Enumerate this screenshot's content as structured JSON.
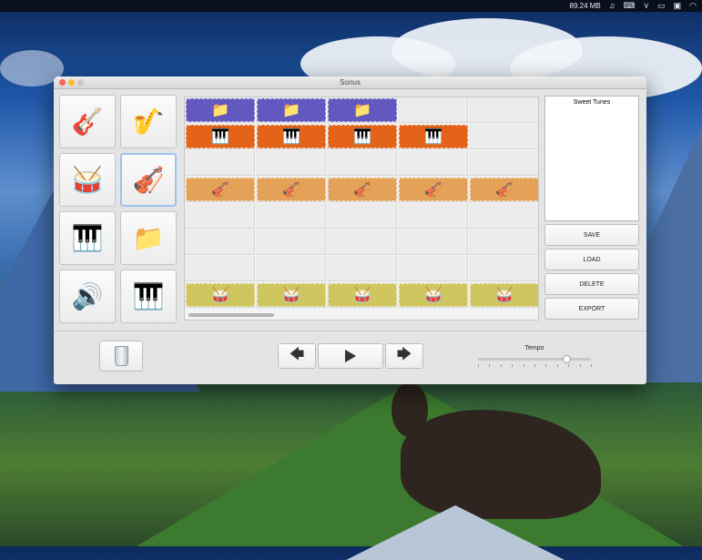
{
  "menubar": {
    "memory": "89.24 MB",
    "icons": [
      "music-icon",
      "keyboard-icon",
      "network-icon",
      "airplay-icon",
      "display-icon",
      "wifi-icon"
    ]
  },
  "window": {
    "title": "Sonus"
  },
  "palette": [
    {
      "name": "electric-guitar-icon",
      "glyph": "🎸"
    },
    {
      "name": "saxophone-icon",
      "glyph": "🎷"
    },
    {
      "name": "drum-kit-icon",
      "glyph": "🥁"
    },
    {
      "name": "violin-icon",
      "glyph": "🎻",
      "selected": true
    },
    {
      "name": "grand-piano-icon",
      "glyph": "🎹"
    },
    {
      "name": "music-folder-icon",
      "glyph": "📁"
    },
    {
      "name": "speaker-icon",
      "glyph": "🔊"
    },
    {
      "name": "synthesizer-icon",
      "glyph": "🎹"
    }
  ],
  "track_rows": [
    {
      "row": 0,
      "instrument": "music-folder-icon",
      "glyph": "📁",
      "color": "#6258bf",
      "cols": 3
    },
    {
      "row": 1,
      "instrument": "synthesizer-icon",
      "glyph": "🎹",
      "color": "#e36418",
      "cols": 4
    },
    {
      "row": 3,
      "instrument": "violin-icon",
      "glyph": "🎻",
      "color": "#e4a258",
      "cols": 5
    },
    {
      "row": 7,
      "instrument": "drum-kit-icon",
      "glyph": "🥁",
      "color": "#cfc660",
      "cols": 5
    }
  ],
  "songlist": {
    "items": [
      "Sweet Tunes"
    ]
  },
  "buttons": {
    "save": "SAVE",
    "load": "LOAD",
    "delete": "DELETE",
    "export": "EXPORT"
  },
  "controls": {
    "back_icon": "arrow-left-icon",
    "play_icon": "play-icon",
    "forward_icon": "arrow-right-icon",
    "trash_icon": "trash-icon"
  },
  "tempo": {
    "label": "Tempo",
    "level": 0.78
  }
}
